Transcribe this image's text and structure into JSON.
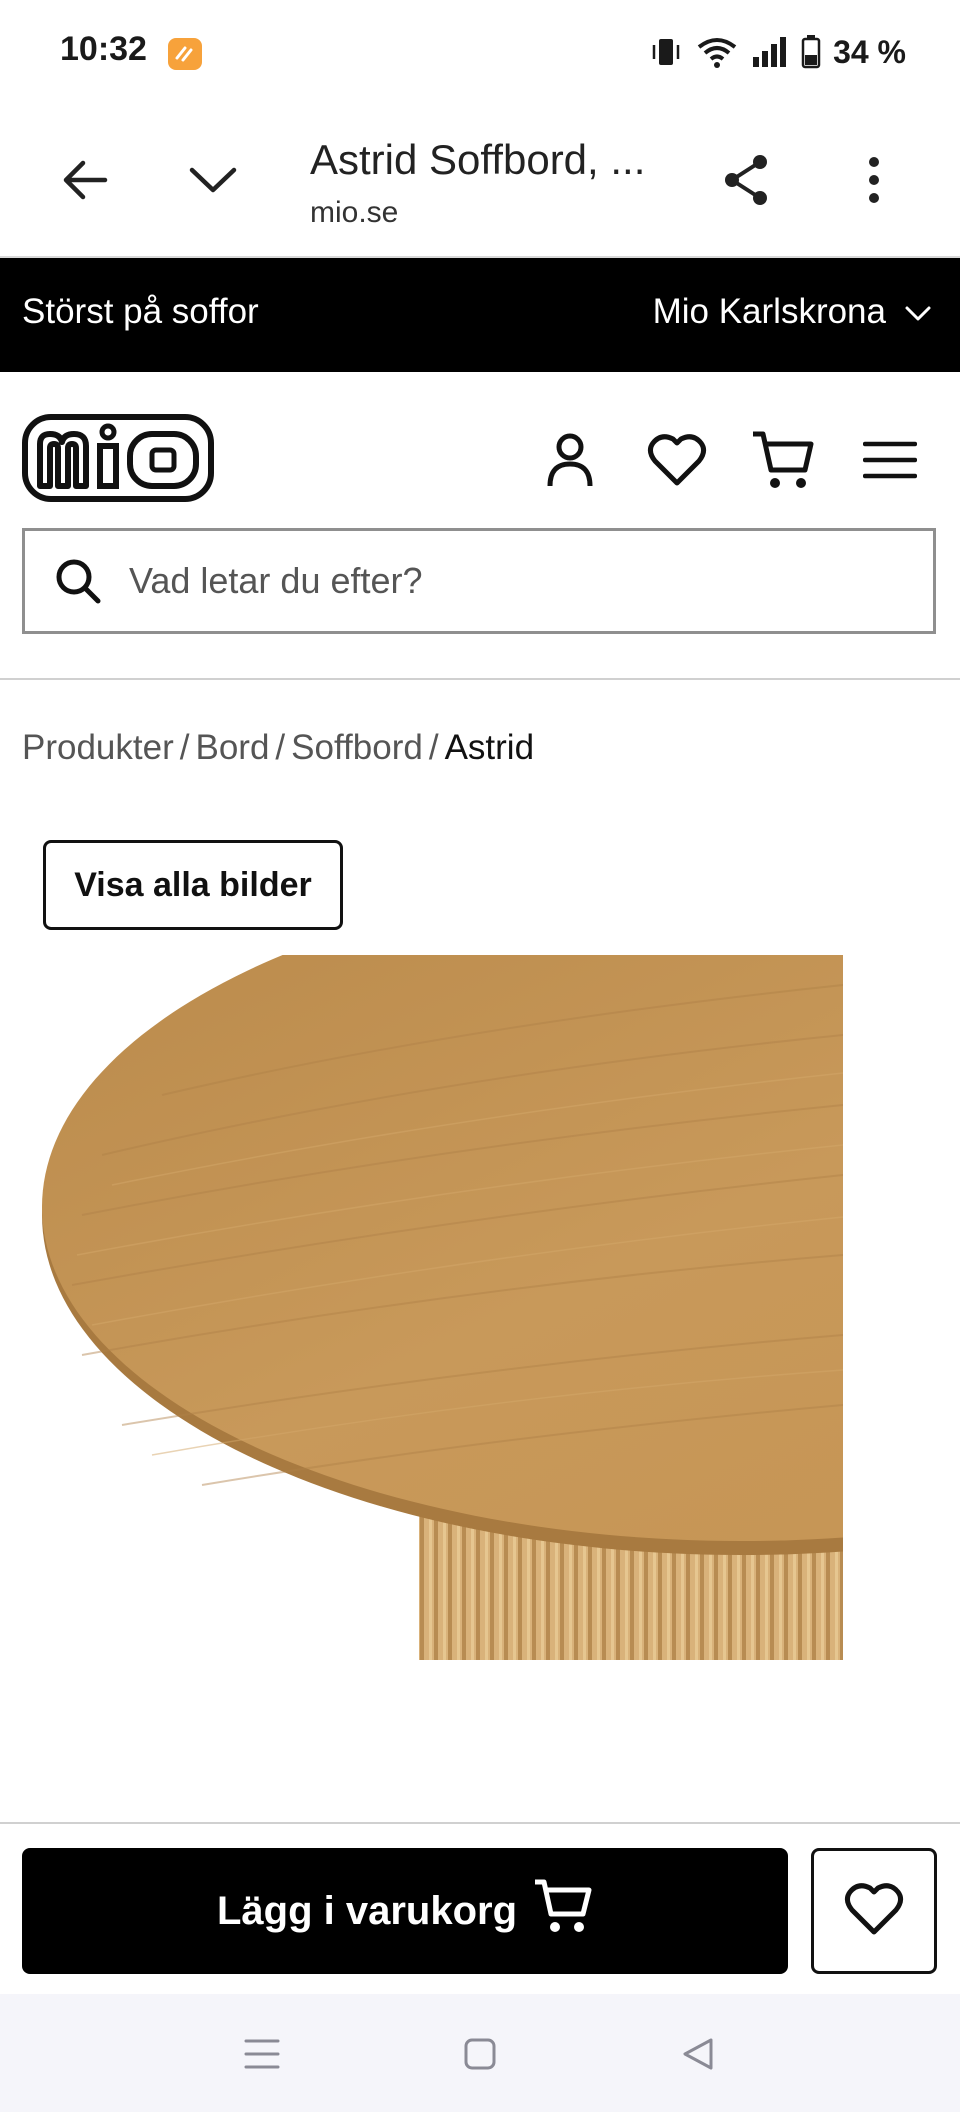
{
  "status_bar": {
    "time": "10:32",
    "battery": "34 %",
    "icons": [
      "notification-app-icon",
      "vibrate-icon",
      "wifi-icon",
      "signal-icon",
      "battery-icon"
    ]
  },
  "browser": {
    "title": "Astrid Soffbord, ...",
    "domain": "mio.se",
    "icons": [
      "back-arrow-icon",
      "chevron-down-icon",
      "share-icon",
      "more-vert-icon"
    ]
  },
  "promo": {
    "left_text": "Störst på soffor",
    "store": "Mio Karlskrona"
  },
  "header": {
    "logo_text": "mio",
    "icons": [
      "account-icon",
      "heart-icon",
      "cart-icon",
      "menu-icon"
    ]
  },
  "search": {
    "placeholder": "Vad letar du efter?"
  },
  "breadcrumb": {
    "items": [
      "Produkter",
      "Bord",
      "Soffbord"
    ],
    "current": "Astrid",
    "separator": "/"
  },
  "gallery": {
    "view_all_label": "Visa alla bilder"
  },
  "actions": {
    "add_to_cart_label": "Lägg i varukorg"
  },
  "colors": {
    "promo_bg": "#000000",
    "badge": "#f7a23b",
    "wood": "#c2924f"
  }
}
